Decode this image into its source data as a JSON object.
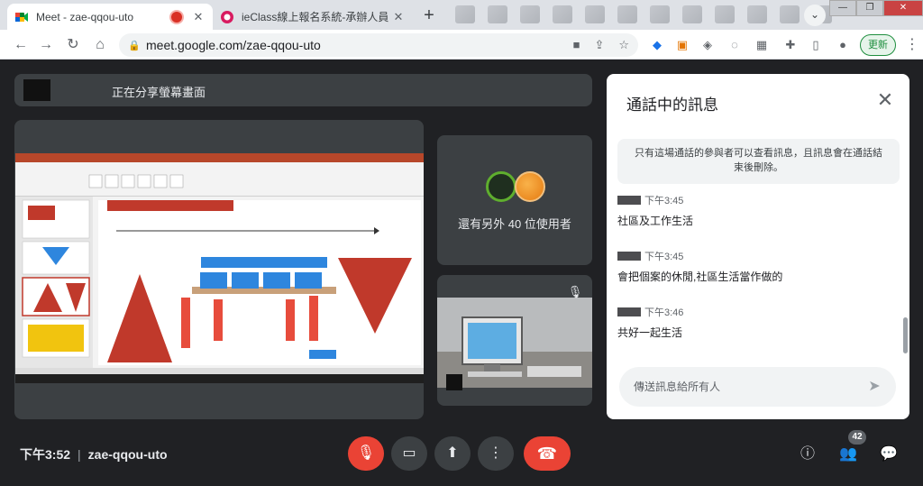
{
  "browser": {
    "tabs": [
      {
        "title": "Meet - zae-qqou-uto",
        "active": true
      },
      {
        "title": "ieClass線上報名系統-承辦人員",
        "active": false
      }
    ],
    "new_tab_icon": "plus-icon",
    "url": "meet.google.com/zae-qqou-uto",
    "update_label": "更新"
  },
  "meet": {
    "presenting_text": "正在分享螢幕畫面",
    "others_label": "還有另外 40 位使用者",
    "meeting_time": "下午3:52",
    "meeting_code": "zae-qqou-uto",
    "participant_count": "42"
  },
  "chat": {
    "title": "通話中的訊息",
    "notice": "只有這場通話的參與者可以查看訊息，且訊息會在通話結束後刪除。",
    "messages": [
      {
        "time": "下午3:45",
        "text": "社區及工作生活"
      },
      {
        "time": "下午3:45",
        "text": "會把個案的休閒,社區生活當作做的"
      },
      {
        "time": "下午3:46",
        "text": "共好一起生活"
      }
    ],
    "input_placeholder": "傳送訊息給所有人"
  },
  "colors": {
    "background": "#202124",
    "tile": "#3c4043",
    "danger": "#ea4335",
    "accent": "#8ab4f8"
  }
}
